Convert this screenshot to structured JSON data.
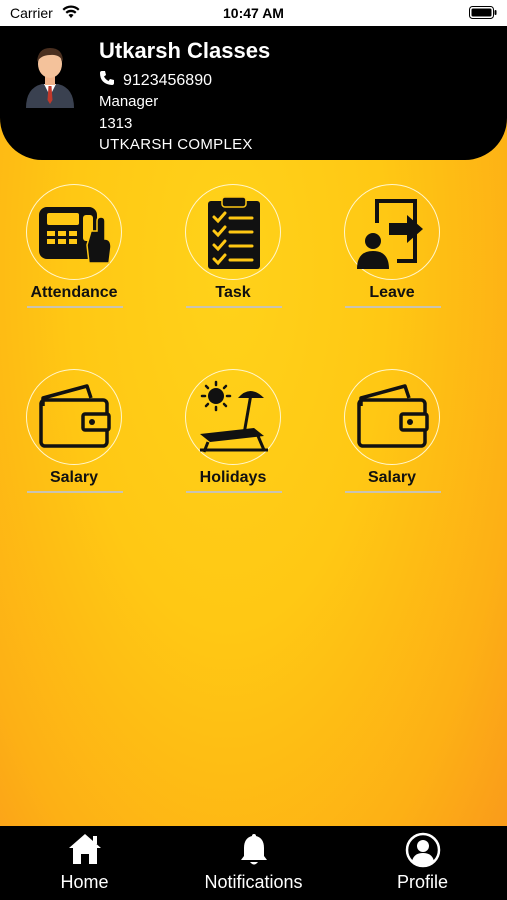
{
  "status_bar": {
    "carrier": "Carrier",
    "time": "10:47 AM"
  },
  "header": {
    "title": "Utkarsh Classes",
    "phone": "9123456890",
    "role": "Manager",
    "code": "1313",
    "complex": "UTKARSH COMPLEX"
  },
  "tiles": [
    {
      "label": "Attendance",
      "icon": "biometric-machine-icon"
    },
    {
      "label": "Task",
      "icon": "clipboard-checklist-icon"
    },
    {
      "label": "Leave",
      "icon": "person-exit-icon"
    },
    {
      "label": "Salary",
      "icon": "wallet-icon"
    },
    {
      "label": "Holidays",
      "icon": "beach-chair-icon"
    },
    {
      "label": "Salary",
      "icon": "wallet-icon"
    }
  ],
  "tabs": [
    {
      "label": "Home",
      "icon": "home-icon"
    },
    {
      "label": "Notifications",
      "icon": "bell-icon"
    },
    {
      "label": "Profile",
      "icon": "profile-icon"
    }
  ]
}
